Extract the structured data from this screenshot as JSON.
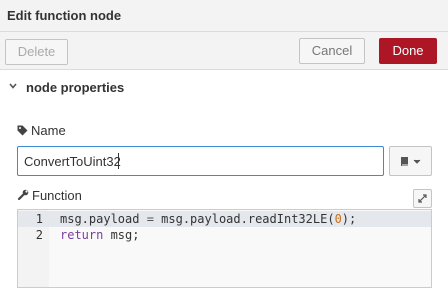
{
  "header": {
    "title": "Edit function node"
  },
  "buttons": {
    "delete": "Delete",
    "cancel": "Cancel",
    "done": "Done"
  },
  "section": {
    "title": "node properties"
  },
  "name_field": {
    "label": "Name",
    "value": "ConvertToUint32"
  },
  "function_field": {
    "label": "Function",
    "lines": [
      {
        "number": "1",
        "text": "msg.payload = msg.payload.readInt32LE(0);"
      },
      {
        "number": "2",
        "text": "return msg;"
      }
    ]
  },
  "colors": {
    "done_button": "#ad1625",
    "input_focus_border": "#3d8ad5",
    "keyword": "#7a3e9d",
    "number": "#c76f1a"
  }
}
